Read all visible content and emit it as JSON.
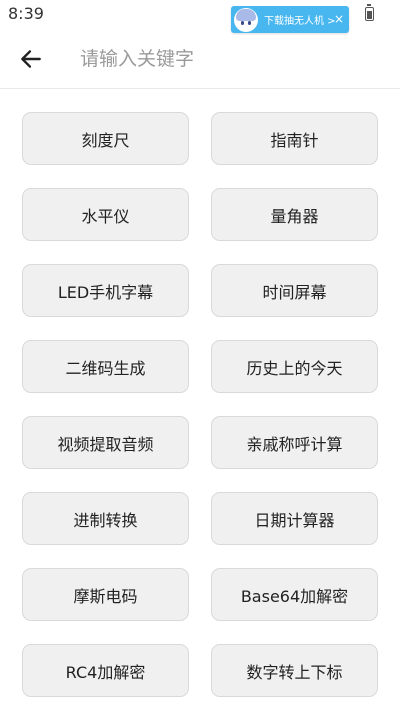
{
  "status_bar": {
    "time": "8:39"
  },
  "ad_banner": {
    "text": "下载抽无人机 >",
    "close_glyph": "×",
    "background_color": "#48b7f0"
  },
  "search": {
    "placeholder": "请输入关键字",
    "value": ""
  },
  "tools": [
    {
      "label": "刻度尺"
    },
    {
      "label": "指南针"
    },
    {
      "label": "水平仪"
    },
    {
      "label": "量角器"
    },
    {
      "label": "LED手机字幕"
    },
    {
      "label": "时间屏幕"
    },
    {
      "label": "二维码生成"
    },
    {
      "label": "历史上的今天"
    },
    {
      "label": "视频提取音频"
    },
    {
      "label": "亲戚称呼计算"
    },
    {
      "label": "进制转换"
    },
    {
      "label": "日期计算器"
    },
    {
      "label": "摩斯电码"
    },
    {
      "label": "Base64加解密"
    },
    {
      "label": "RC4加解密"
    },
    {
      "label": "数字转上下标"
    }
  ],
  "icons": {
    "back": "arrow-left-icon",
    "battery": "battery-icon",
    "close": "close-icon"
  }
}
